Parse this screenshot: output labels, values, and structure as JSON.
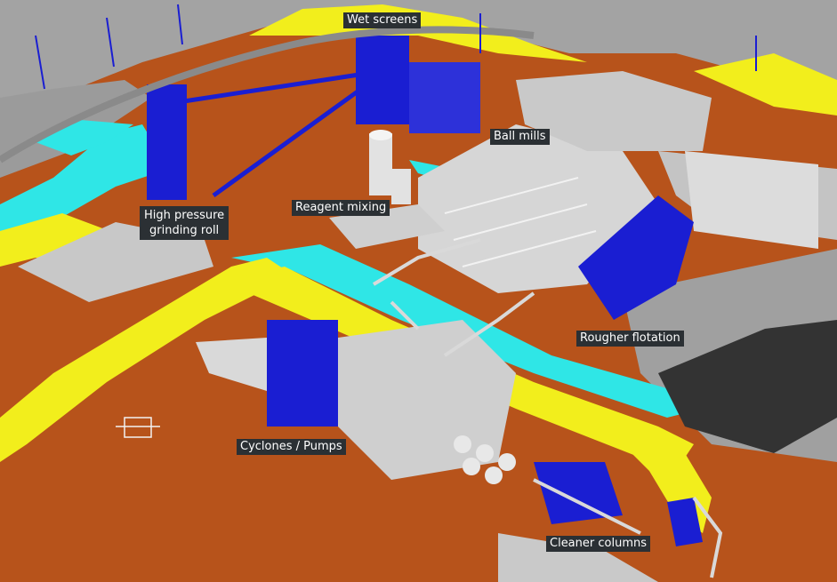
{
  "labels": {
    "wet_screens": "Wet screens",
    "ball_mills": "Ball mills",
    "hpgr_line1": "High pressure",
    "hpgr_line2": "grinding roll",
    "reagent_mixing": "Reagent mixing",
    "rougher_flotation": "Rougher flotation",
    "cyclones_pumps": "Cyclones / Pumps",
    "cleaner_columns": "Cleaner columns"
  },
  "colors": {
    "ground_orange": "#b7531b",
    "road_yellow": "#f2ee1c",
    "water_cyan": "#2fe6e6",
    "steel_blue": "#1a1ed2",
    "structure_grey": "#d9d9d9",
    "terrain_grey": "#a9a9a9",
    "label_bg": "#2b3034"
  }
}
